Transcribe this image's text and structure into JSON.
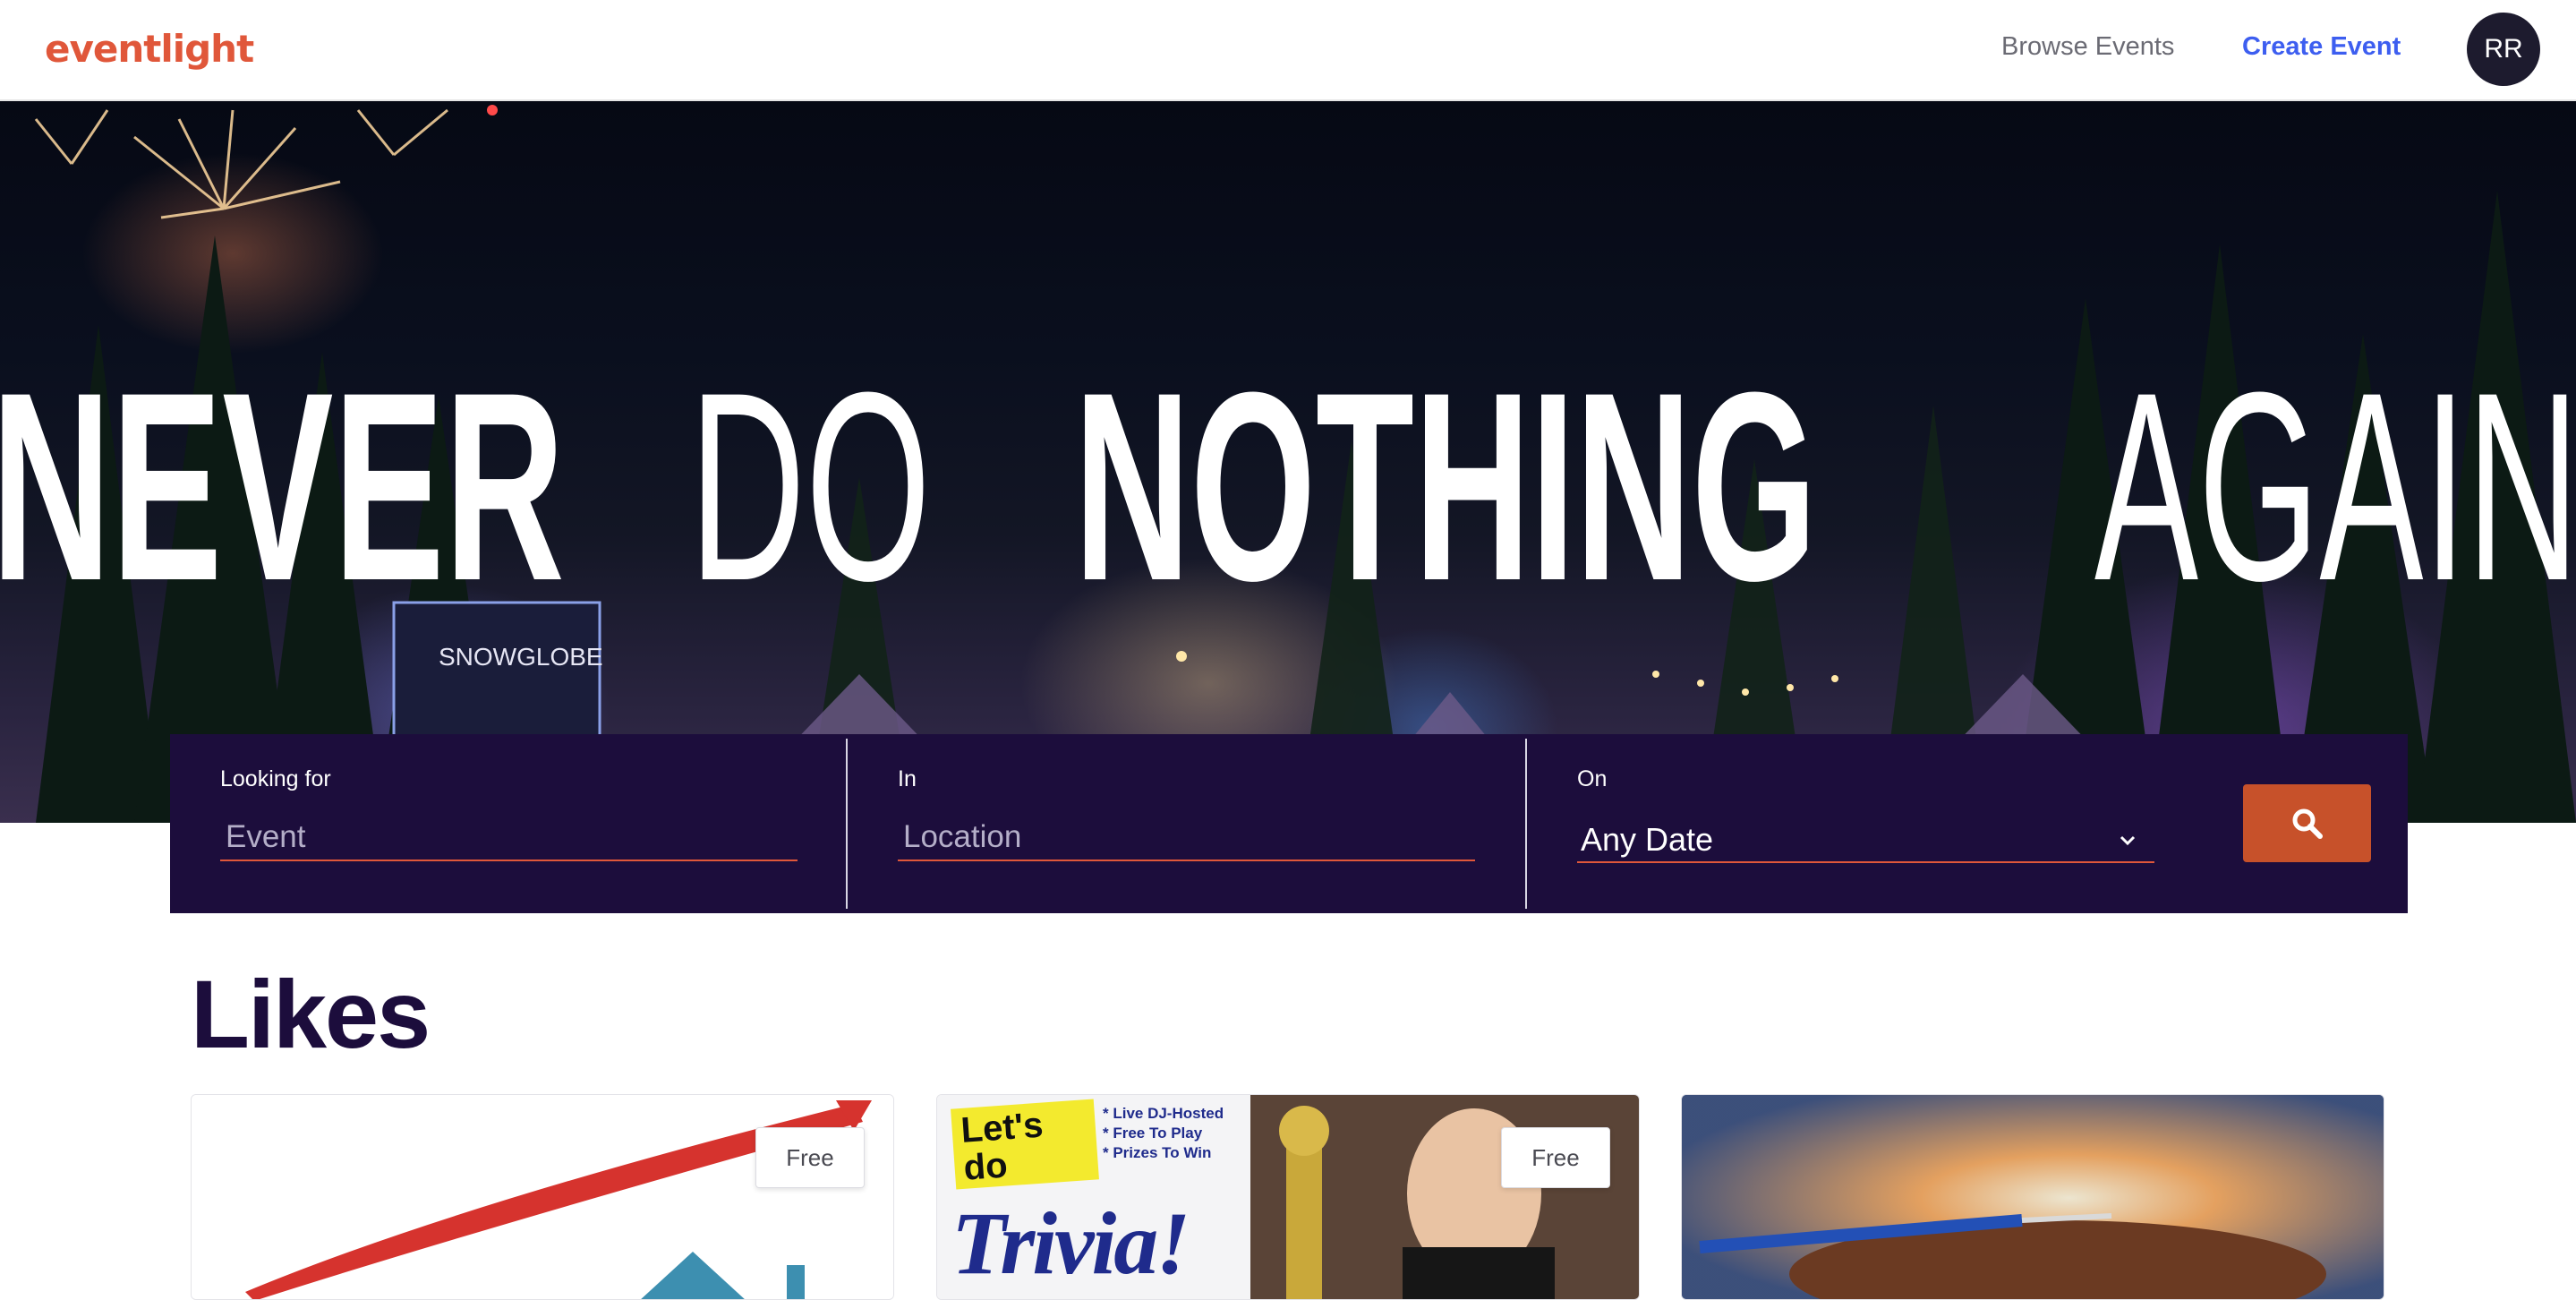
{
  "app": {
    "brand": "eventlight"
  },
  "nav": {
    "browse_label": "Browse Events",
    "create_label": "Create Event",
    "avatar_initials": "RR"
  },
  "hero": {
    "headline_words": [
      "NEVER",
      "DO",
      "NOTHING",
      "AGAIN"
    ],
    "stage_sign": "SNOWGLOBE"
  },
  "search": {
    "looking_label": "Looking for",
    "looking_placeholder": "Event",
    "in_label": "In",
    "in_placeholder": "Location",
    "on_label": "On",
    "on_value": "Any Date",
    "button_icon": "search-icon"
  },
  "likes": {
    "title": "Likes",
    "cards": [
      {
        "price": "Free",
        "image": "house-arrow-chart"
      },
      {
        "price": "Free",
        "image": "trivia-poster",
        "poster_title": "Let's do",
        "poster_word": "Trivia!",
        "poster_bullets": [
          "* Live DJ-Hosted",
          "* Free To Play",
          "* Prizes To Win"
        ]
      },
      {
        "price": "",
        "image": "grill-flames"
      }
    ]
  },
  "colors": {
    "brand": "#e0573a",
    "primary_link": "#3d5ef0",
    "search_bg": "#1c0d3c",
    "search_button": "#c7512a",
    "heading": "#1c0d3c"
  }
}
